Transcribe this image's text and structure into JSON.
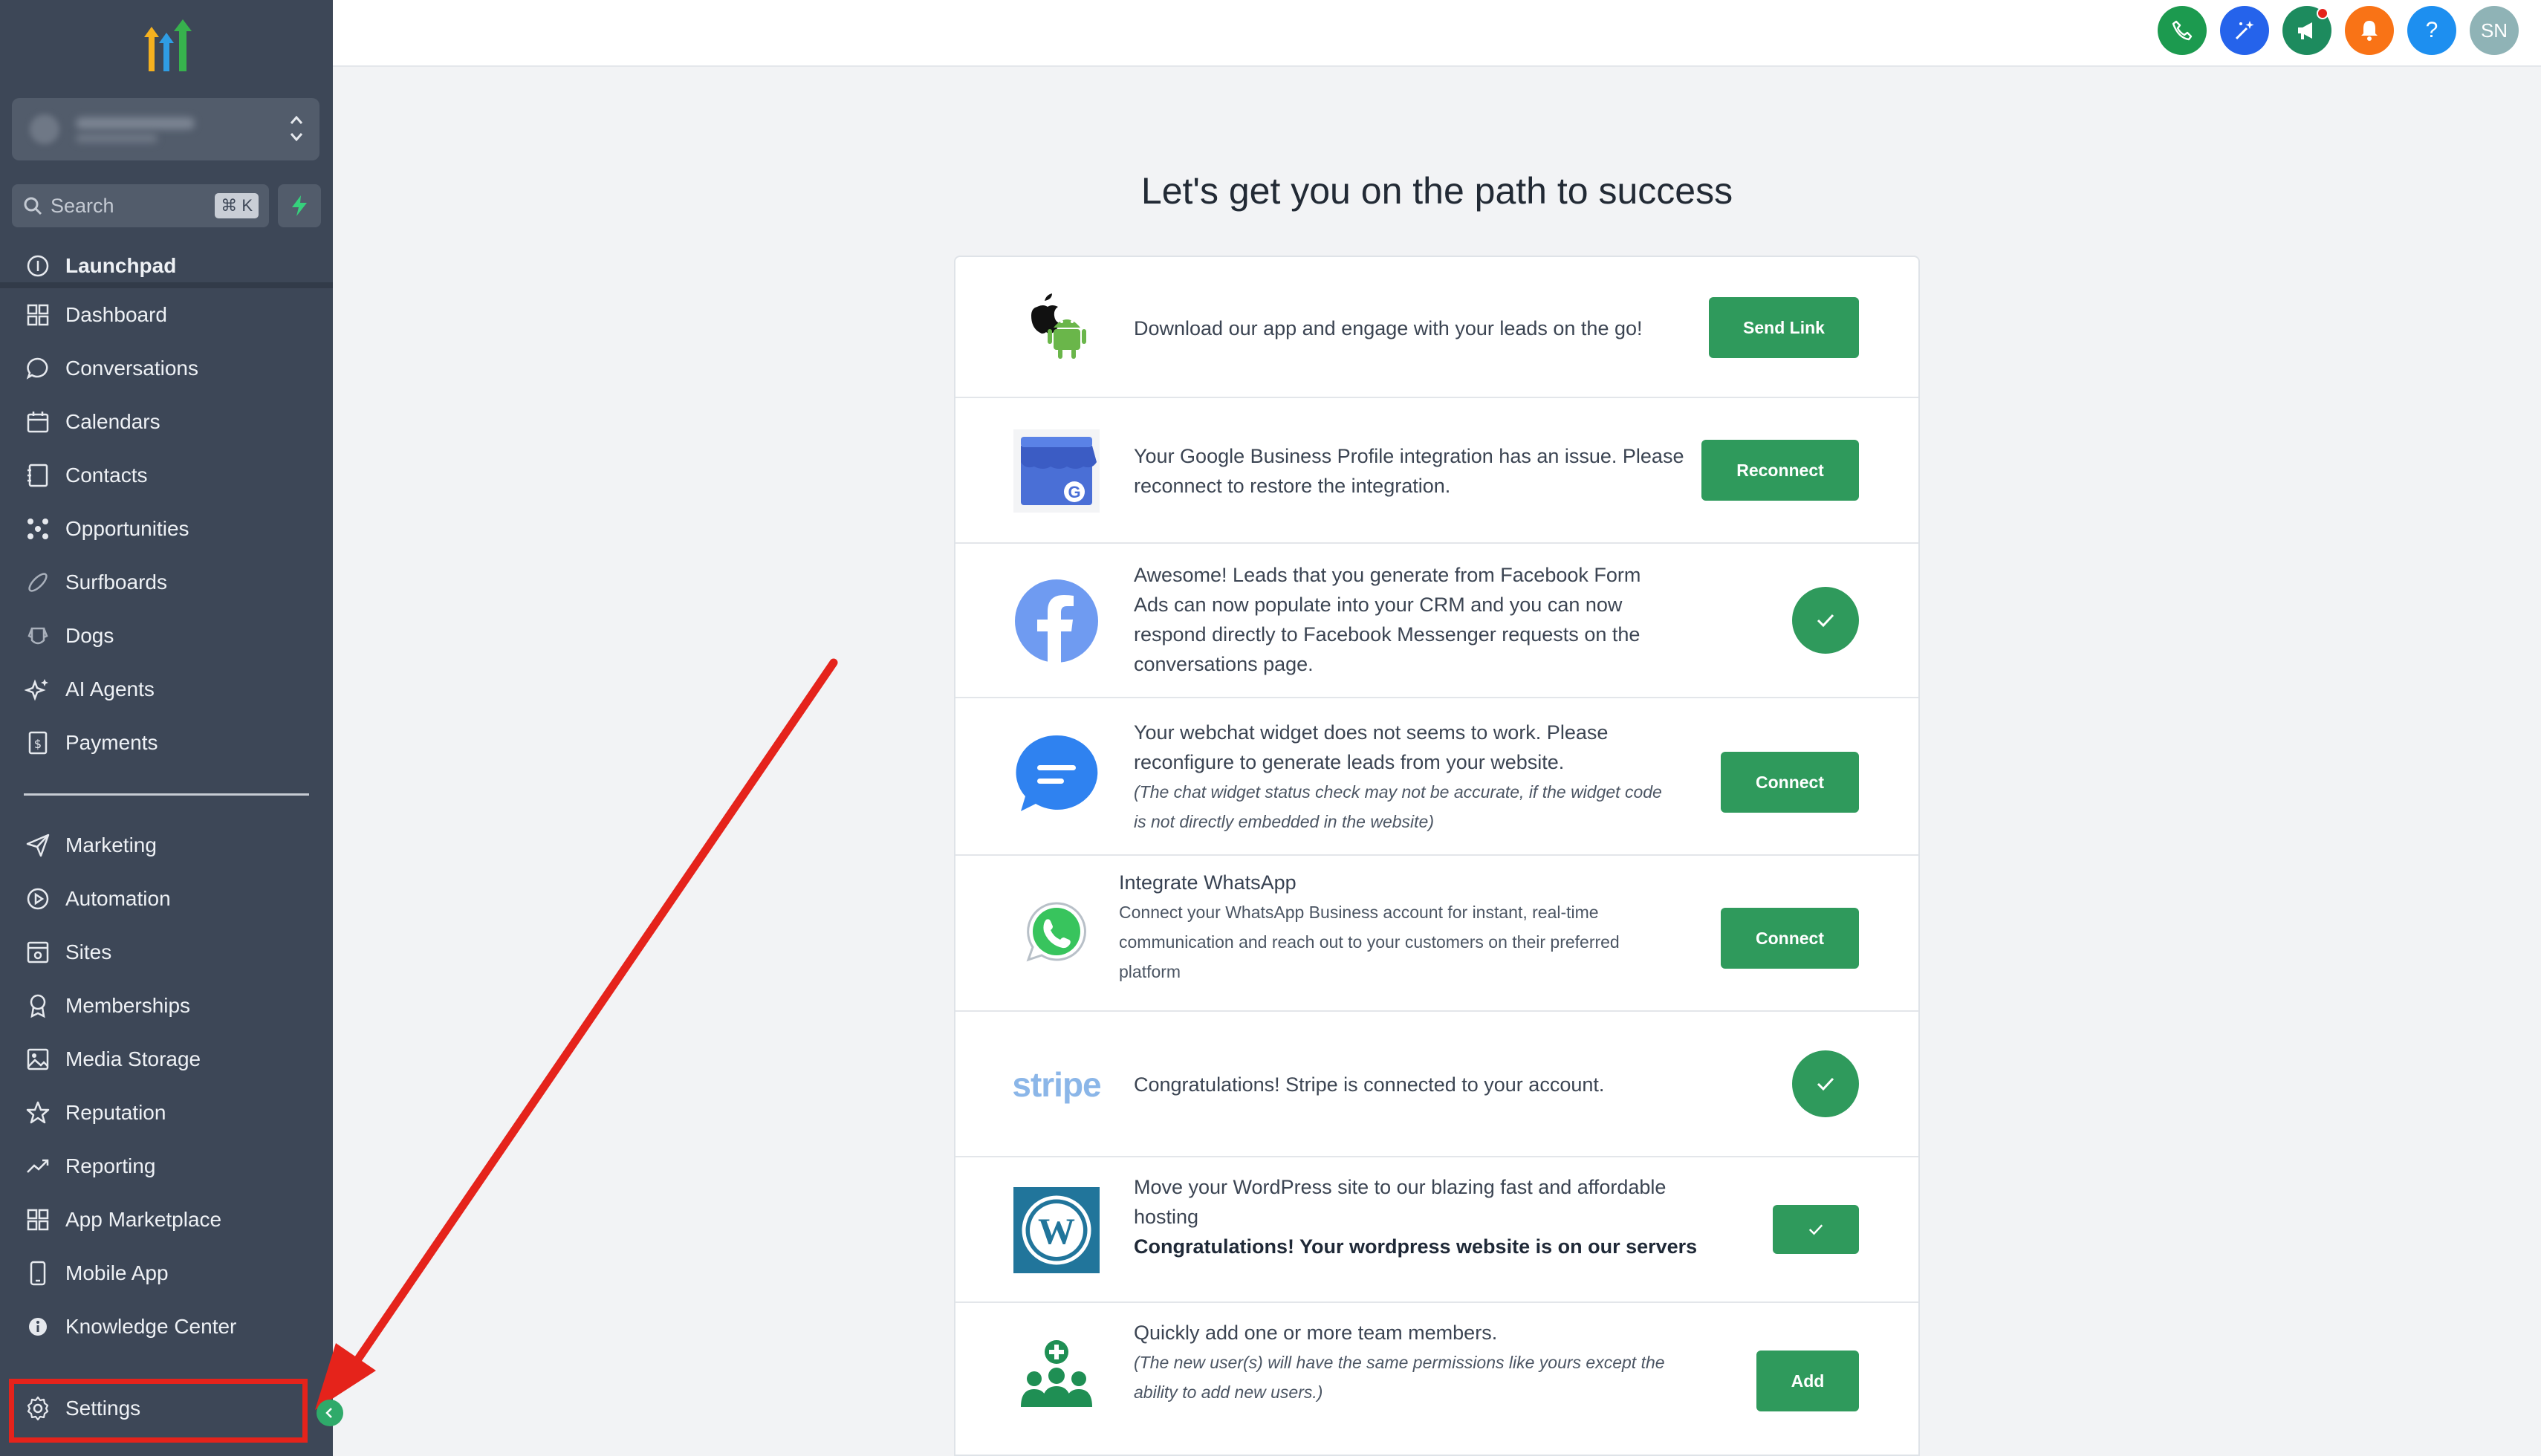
{
  "sidebar": {
    "search_placeholder": "Search",
    "search_shortcut": "⌘ K",
    "partial_item": "Launchpad",
    "items": [
      {
        "label": "Dashboard",
        "icon": "dashboard-icon"
      },
      {
        "label": "Conversations",
        "icon": "chat-bubble-icon"
      },
      {
        "label": "Calendars",
        "icon": "calendar-icon"
      },
      {
        "label": "Contacts",
        "icon": "contacts-icon"
      },
      {
        "label": "Opportunities",
        "icon": "opportunities-icon"
      },
      {
        "label": "Surfboards",
        "icon": "surfboard-icon"
      },
      {
        "label": "Dogs",
        "icon": "dog-icon"
      },
      {
        "label": "AI Agents",
        "icon": "sparkle-icon"
      },
      {
        "label": "Payments",
        "icon": "invoice-icon"
      }
    ],
    "items2": [
      {
        "label": "Marketing",
        "icon": "send-icon"
      },
      {
        "label": "Automation",
        "icon": "automation-icon"
      },
      {
        "label": "Sites",
        "icon": "sites-icon"
      },
      {
        "label": "Memberships",
        "icon": "award-icon"
      },
      {
        "label": "Media Storage",
        "icon": "image-icon"
      },
      {
        "label": "Reputation",
        "icon": "star-icon"
      },
      {
        "label": "Reporting",
        "icon": "trend-icon"
      },
      {
        "label": "App Marketplace",
        "icon": "grid-icon"
      },
      {
        "label": "Mobile App",
        "icon": "mobile-icon"
      },
      {
        "label": "Knowledge Center",
        "icon": "info-icon"
      }
    ],
    "settings_label": "Settings"
  },
  "topbar": {
    "avatar_initials": "SN",
    "help_label": "?"
  },
  "colors": {
    "sidebar_bg": "#3d4757",
    "accent_green": "#2f9a5c",
    "highlight_red": "#e5231b"
  },
  "main": {
    "heading": "Let's get you on the path to success",
    "rows": [
      {
        "icon": "apple-android-icon",
        "text": "Download our app and engage with your leads on the go!",
        "action": "Send Link"
      },
      {
        "icon": "google-business-icon",
        "text": "Your Google Business Profile integration has an issue. Please reconnect to restore the integration.",
        "action": "Reconnect"
      },
      {
        "icon": "facebook-icon",
        "text": "Awesome! Leads that you generate from Facebook Form Ads can now populate into your CRM and you can now respond directly to Facebook Messenger requests on the conversations page.",
        "status": "connected"
      },
      {
        "icon": "webchat-icon",
        "text": "Your webchat widget does not seems to work. Please reconfigure to generate leads from your website.",
        "note": "(The chat widget status check may not be accurate, if the widget code is not directly embedded in the website)",
        "action": "Connect"
      },
      {
        "icon": "whatsapp-icon",
        "title": "Integrate WhatsApp",
        "text": "Connect your WhatsApp Business account for instant, real-time communication and reach out to your customers on their preferred platform",
        "action": "Connect"
      },
      {
        "icon": "stripe-icon",
        "logo_text": "stripe",
        "text": "Congratulations! Stripe is connected to your account.",
        "status": "connected"
      },
      {
        "icon": "wordpress-icon",
        "text": "Move your WordPress site to our blazing fast and affordable hosting",
        "bold": "Congratulations! Your wordpress website is on our servers",
        "status": "connected"
      },
      {
        "icon": "team-add-icon",
        "text": "Quickly add one or more team members.",
        "note": "(The new user(s) will have the same permissions like yours except the ability to add new users.)",
        "action": "Add"
      }
    ]
  }
}
